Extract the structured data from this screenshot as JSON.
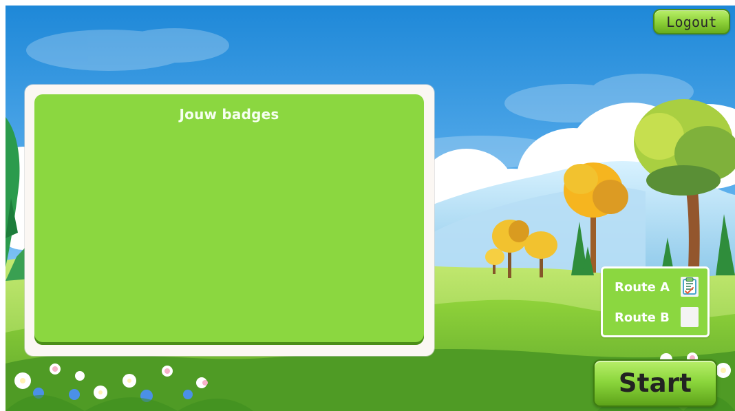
{
  "header": {
    "logout_label": "Logout"
  },
  "badge_panel": {
    "title": "Jouw badges"
  },
  "routes": [
    {
      "label": "Route A",
      "checked": true
    },
    {
      "label": "Route B",
      "checked": false
    }
  ],
  "start_button": {
    "label": "Start"
  },
  "theme": {
    "sky_top": "#1e88d8",
    "sky_bottom": "#e5f3ff",
    "panel_green": "#8bd740",
    "panel_border_green": "#4b8d18",
    "button_green": "#8ad53b",
    "checkbox_border": "#4aa6cc",
    "checkbox_accent": "#7fc66b"
  }
}
